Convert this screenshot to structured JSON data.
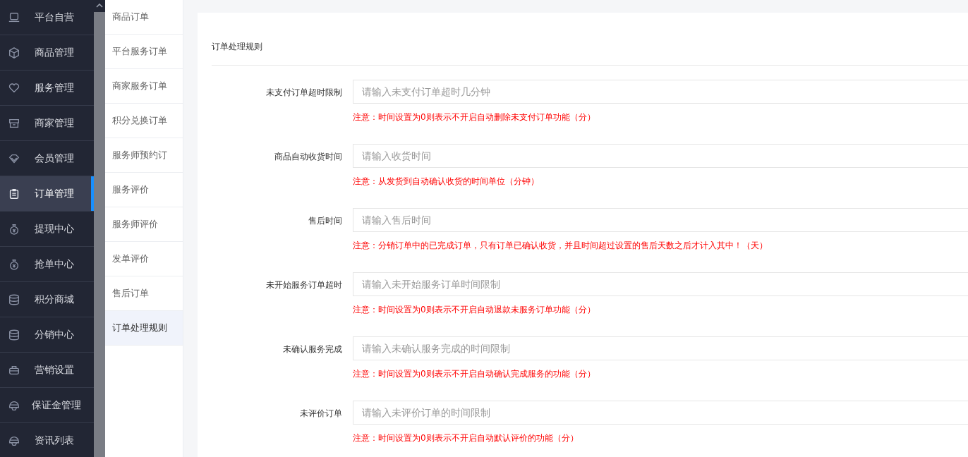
{
  "sidebar": {
    "items": [
      {
        "label": "平台自营",
        "selected": false
      },
      {
        "label": "商品管理",
        "selected": false
      },
      {
        "label": "服务管理",
        "selected": false
      },
      {
        "label": "商家管理",
        "selected": false
      },
      {
        "label": "会员管理",
        "selected": false
      },
      {
        "label": "订单管理",
        "selected": true
      },
      {
        "label": "提现中心",
        "selected": false
      },
      {
        "label": "抢单中心",
        "selected": false
      },
      {
        "label": "积分商城",
        "selected": false
      },
      {
        "label": "分销中心",
        "selected": false
      },
      {
        "label": "营销设置",
        "selected": false
      },
      {
        "label": "保证金管理",
        "selected": false
      },
      {
        "label": "资讯列表",
        "selected": false
      }
    ]
  },
  "submenu": {
    "items": [
      {
        "label": "商品订单",
        "selected": false
      },
      {
        "label": "平台服务订单",
        "selected": false
      },
      {
        "label": "商家服务订单",
        "selected": false
      },
      {
        "label": "积分兑换订单",
        "selected": false
      },
      {
        "label": "服务师预约订",
        "selected": false
      },
      {
        "label": "服务评价",
        "selected": false
      },
      {
        "label": "服务师评价",
        "selected": false
      },
      {
        "label": "发单评价",
        "selected": false
      },
      {
        "label": "售后订单",
        "selected": false
      },
      {
        "label": "订单处理规则",
        "selected": true
      }
    ]
  },
  "form": {
    "title": "订单处理规则",
    "fields": [
      {
        "label": "未支付订单超时限制",
        "placeholder": "请输入未支付订单超时几分钟",
        "note": "注意：时间设置为0则表示不开启自动删除未支付订单功能（分）"
      },
      {
        "label": "商品自动收货时间",
        "placeholder": "请输入收货时间",
        "note": "注意：从发货到自动确认收货的时间单位（分钟）"
      },
      {
        "label": "售后时间",
        "placeholder": "请输入售后时间",
        "note": "注意：分销订单中的已完成订单，只有订单已确认收货，并且时间超过设置的售后天数之后才计入其中！（天）"
      },
      {
        "label": "未开始服务订单超时",
        "placeholder": "请输入未开始服务订单时间限制",
        "note": "注意：时间设置为0则表示不开启自动退款未服务订单功能（分）"
      },
      {
        "label": "未确认服务完成",
        "placeholder": "请输入未确认服务完成的时间限制",
        "note": "注意：时间设置为0则表示不开启自动确认完成服务的功能（分）"
      },
      {
        "label": "未评价订单",
        "placeholder": "请输入未评价订单的时间限制",
        "note": "注意：时间设置为0则表示不开启自动默认评价的功能（分）"
      }
    ]
  }
}
